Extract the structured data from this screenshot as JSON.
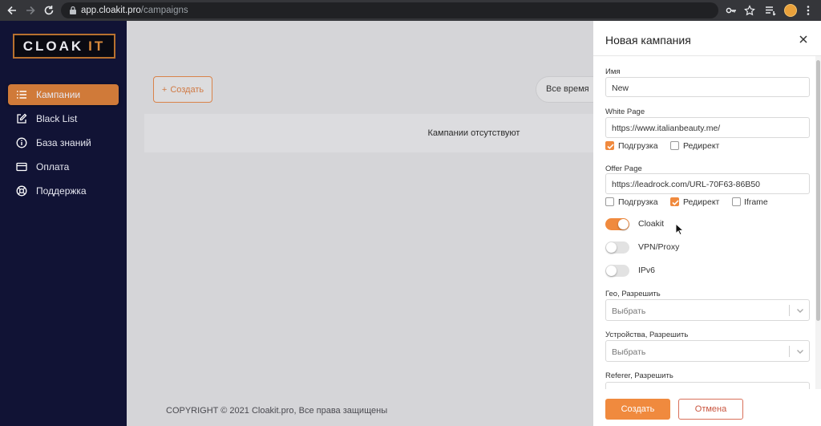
{
  "browser": {
    "url_domain": "app.cloakit.pro",
    "url_path": "/campaigns",
    "icons": [
      "back-arrow-icon",
      "forward-arrow-icon",
      "reload-icon",
      "lock-icon",
      "key-icon",
      "star-icon",
      "tab-list-icon",
      "profile-avatar-icon",
      "kebab-menu-icon"
    ]
  },
  "sidebar": {
    "logo": {
      "part1": "CLOAK",
      "part2": "IT"
    },
    "items": [
      {
        "label": "Кампании",
        "icon": "list-icon",
        "active": true
      },
      {
        "label": "Black List",
        "icon": "edit-icon",
        "active": false
      },
      {
        "label": "База знаний",
        "icon": "info-icon",
        "active": false
      },
      {
        "label": "Оплата",
        "icon": "card-icon",
        "active": false
      },
      {
        "label": "Поддержка",
        "icon": "lifebuoy-icon",
        "active": false
      }
    ]
  },
  "main": {
    "create_button": "Создать",
    "create_icon": "plus-icon",
    "period_filter": "Все время",
    "empty_message": "Кампании отсутствуют",
    "footer": "COPYRIGHT © 2021 Cloakit.pro, Все права защищены"
  },
  "panel": {
    "title": "Новая кампания",
    "close_icon": "close-icon",
    "fields": {
      "name": {
        "label": "Имя",
        "value": "New"
      },
      "white_page": {
        "label": "White Page",
        "value": "https://www.italianbeauty.me/",
        "options": [
          {
            "label": "Подгрузка",
            "checked": true
          },
          {
            "label": "Редирект",
            "checked": false
          }
        ]
      },
      "offer_page": {
        "label": "Offer Page",
        "value": "https://leadrock.com/URL-70F63-86B50",
        "options": [
          {
            "label": "Подгрузка",
            "checked": false
          },
          {
            "label": "Редирект",
            "checked": true
          },
          {
            "label": "Iframe",
            "checked": false
          }
        ]
      },
      "toggles": [
        {
          "label": "Cloakit",
          "on": true
        },
        {
          "label": "VPN/Proxy",
          "on": false
        },
        {
          "label": "IPv6",
          "on": false
        }
      ],
      "geo": {
        "label": "Гео, Разрешить",
        "placeholder": "Выбрать"
      },
      "devices": {
        "label": "Устройства, Разрешить",
        "placeholder": "Выбрать"
      },
      "referer": {
        "label": "Referer, Разрешить",
        "value": ""
      }
    },
    "submit_button": "Создать",
    "cancel_button": "Отмена"
  },
  "colors": {
    "accent": "#f08a3e",
    "sidebar_bg": "#111335",
    "logo_border": "#b8712f",
    "main_bg": "#d5d5d8",
    "cancel": "#c9553f"
  }
}
